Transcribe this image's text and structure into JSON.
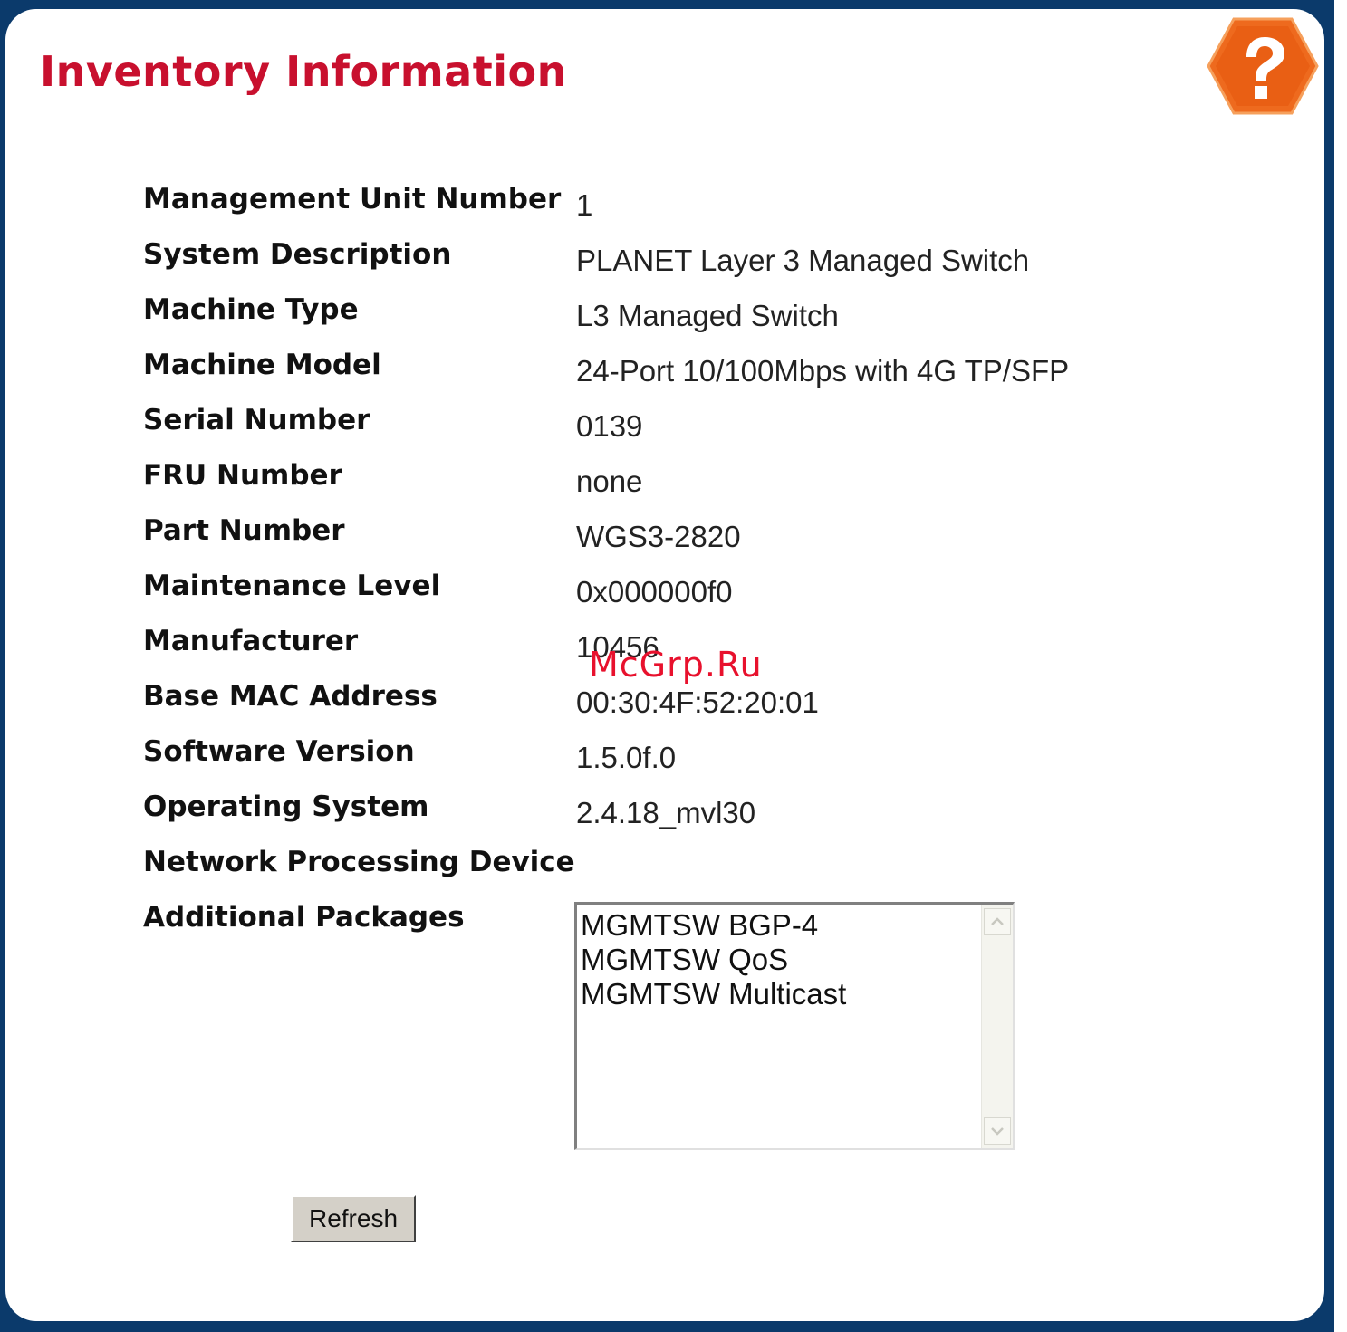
{
  "page": {
    "title": "Inventory Information",
    "help_icon": "help-question-hexagon-icon",
    "accent_color": "#c8102e",
    "help_color": "#ee6a1e",
    "frame_color": "#0b3a6b"
  },
  "fields": [
    {
      "label": "Management Unit Number",
      "value": "1"
    },
    {
      "label": "System Description",
      "value": "PLANET Layer 3 Managed Switch"
    },
    {
      "label": "Machine Type",
      "value": "L3 Managed Switch"
    },
    {
      "label": "Machine Model",
      "value": "24-Port 10/100Mbps with 4G TP/SFP"
    },
    {
      "label": "Serial Number",
      "value": "0139"
    },
    {
      "label": "FRU Number",
      "value": "none"
    },
    {
      "label": "Part Number",
      "value": "WGS3-2820"
    },
    {
      "label": "Maintenance Level",
      "value": "0x000000f0"
    },
    {
      "label": "Manufacturer",
      "value": "10456"
    },
    {
      "label": "Base MAC Address",
      "value": "00:30:4F:52:20:01"
    },
    {
      "label": "Software Version",
      "value": "1.5.0f.0"
    },
    {
      "label": "Operating System",
      "value": "2.4.18_mvl30"
    },
    {
      "label": "Network Processing Device",
      "value": ""
    },
    {
      "label": "Additional Packages",
      "value": ""
    }
  ],
  "additional_packages": [
    "MGMTSW BGP-4",
    "MGMTSW QoS",
    "MGMTSW Multicast"
  ],
  "buttons": {
    "refresh_label": "Refresh"
  },
  "watermark": "McGrp.Ru"
}
